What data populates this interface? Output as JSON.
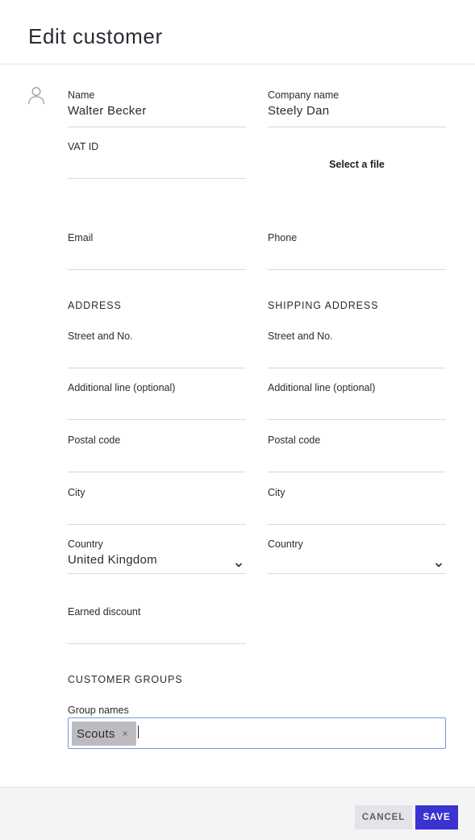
{
  "header": {
    "title": "Edit customer"
  },
  "icons": {
    "user": "user-icon",
    "select_chevron": "chevron-down-icon",
    "chip_remove": "close-icon"
  },
  "customer": {
    "name_label": "Name",
    "name_value": "Walter Becker",
    "company_label": "Company name",
    "company_value": "Steely Dan",
    "vat_label": "VAT ID",
    "vat_value": "",
    "file_button": "Select a file",
    "email_label": "Email",
    "email_value": "",
    "phone_label": "Phone",
    "phone_value": ""
  },
  "address": {
    "heading": "ADDRESS",
    "street_label": "Street and No.",
    "street_value": "",
    "additional_label": "Additional line (optional)",
    "additional_value": "",
    "postal_label": "Postal code",
    "postal_value": "",
    "city_label": "City",
    "city_value": "",
    "country_label": "Country",
    "country_value": "United Kingdom"
  },
  "shipping": {
    "heading": "SHIPPING ADDRESS",
    "street_label": "Street and No.",
    "street_value": "",
    "additional_label": "Additional line (optional)",
    "additional_value": "",
    "postal_label": "Postal code",
    "postal_value": "",
    "city_label": "City",
    "city_value": "",
    "country_label": "Country",
    "country_value": ""
  },
  "discount": {
    "label": "Earned discount",
    "value": ""
  },
  "groups": {
    "heading": "CUSTOMER GROUPS",
    "label": "Group names",
    "chips": [
      "Scouts"
    ],
    "remove_symbol": "×"
  },
  "footer": {
    "cancel_label": "CANCEL",
    "save_label": "SAVE"
  },
  "colors": {
    "accent": "#3a33d1",
    "focus_border": "#7a93e8",
    "chip_bg": "#bcbcc0"
  }
}
